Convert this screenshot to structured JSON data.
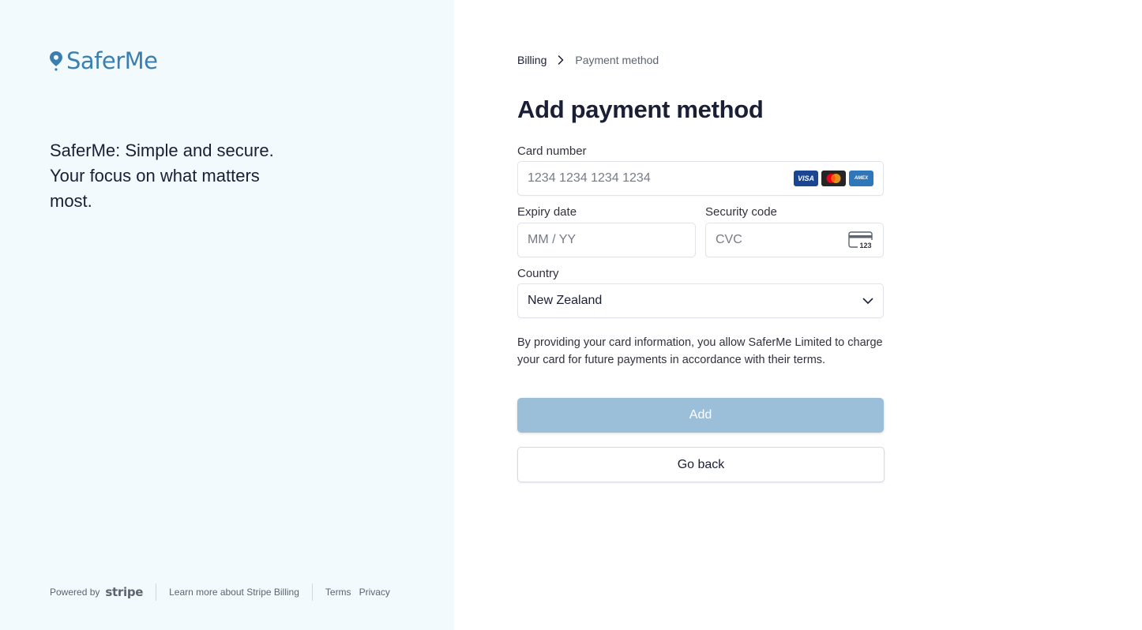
{
  "brand": {
    "name": "SaferMe",
    "color": "#3b7fb0"
  },
  "tagline": "SaferMe: Simple and secure. Your focus on what matters most.",
  "footer": {
    "powered_by": "Powered by",
    "stripe": "stripe",
    "learn_more": "Learn more about Stripe Billing",
    "terms": "Terms",
    "privacy": "Privacy"
  },
  "breadcrumb": {
    "parent": "Billing",
    "current": "Payment method"
  },
  "title": "Add payment method",
  "form": {
    "card_number": {
      "label": "Card number",
      "placeholder": "1234 1234 1234 1234",
      "brands": [
        "visa",
        "mastercard",
        "amex"
      ]
    },
    "expiry": {
      "label": "Expiry date",
      "placeholder": "MM / YY"
    },
    "security_code": {
      "label": "Security code",
      "placeholder": "CVC",
      "icon_text": "123"
    },
    "country": {
      "label": "Country",
      "value": "New Zealand"
    }
  },
  "notice": "By providing your card information, you allow SaferMe Limited to charge your card for future payments in accordance with their terms.",
  "buttons": {
    "add": "Add",
    "back": "Go back"
  },
  "colors": {
    "left_bg": "#f2fafd",
    "add_button": "#9bbfd9",
    "text": "#1a1f36"
  }
}
